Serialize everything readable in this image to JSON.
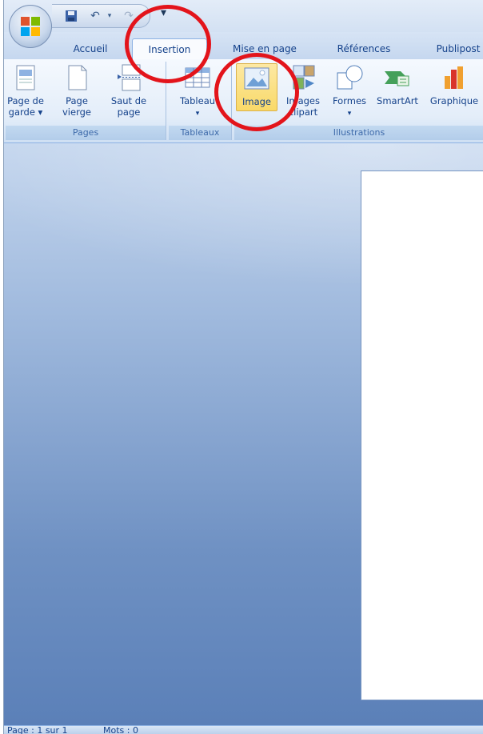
{
  "quick_access": {
    "save": "save-icon",
    "undo": "undo-icon",
    "redo": "redo-icon",
    "more": "▾"
  },
  "tabs": [
    {
      "label": "Accueil"
    },
    {
      "label": "Insertion",
      "active": true
    },
    {
      "label": "Mise en page"
    },
    {
      "label": "Références"
    },
    {
      "label": "Publipost"
    }
  ],
  "groups": {
    "pages": {
      "label": "Pages",
      "buttons": [
        {
          "line1": "Page de",
          "line2": "garde ▾"
        },
        {
          "line1": "Page",
          "line2": "vierge"
        },
        {
          "line1": "Saut de",
          "line2": "page"
        }
      ]
    },
    "tableaux": {
      "label": "Tableaux",
      "buttons": [
        {
          "line1": "Tableau",
          "line2": "▾"
        }
      ]
    },
    "illustrations": {
      "label": "Illustrations",
      "buttons": [
        {
          "line1": "Image",
          "line2": ""
        },
        {
          "line1": "Images",
          "line2": "clipart"
        },
        {
          "line1": "Formes",
          "line2": "▾"
        },
        {
          "line1": "SmartArt",
          "line2": ""
        },
        {
          "line1": "Graphique",
          "line2": ""
        }
      ]
    }
  },
  "status": {
    "page": "Page : 1 sur 1",
    "words": "Mots : 0"
  },
  "colors": {
    "annotation": "#e3141b",
    "ribbon_text": "#15428b"
  }
}
